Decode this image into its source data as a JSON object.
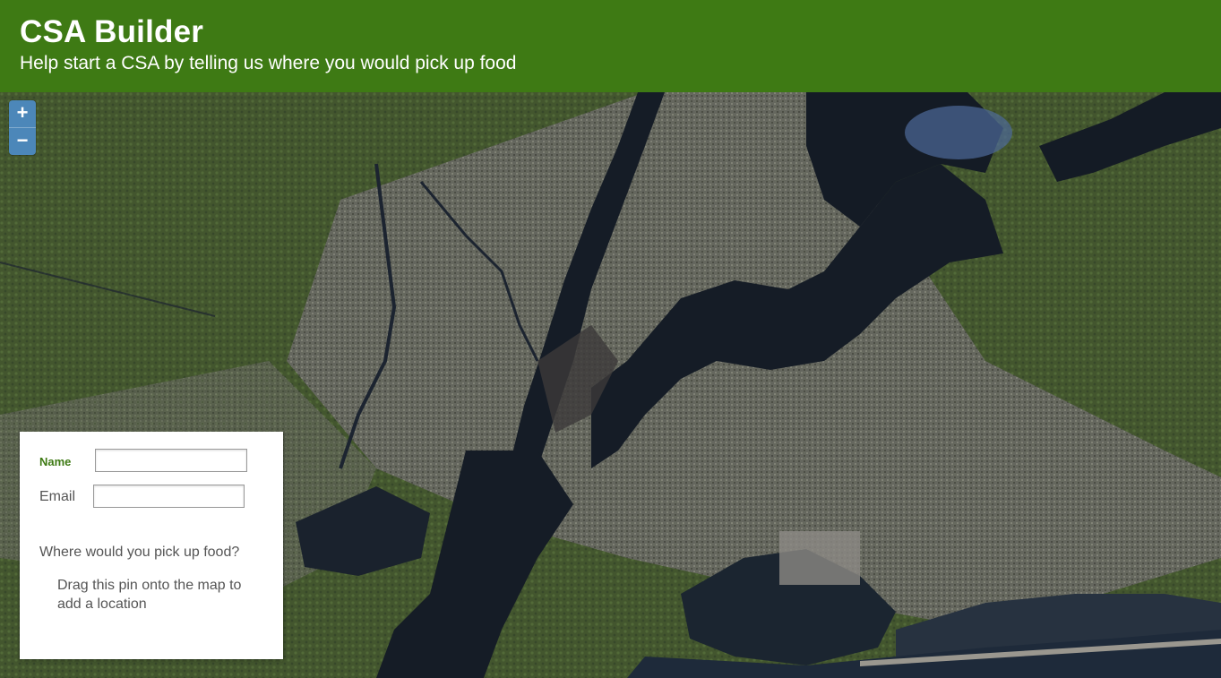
{
  "header": {
    "title": "CSA Builder",
    "subtitle": "Help start a CSA by telling us where you would pick up food"
  },
  "zoom": {
    "in_label": "+",
    "out_label": "−"
  },
  "form": {
    "name_label": "Name",
    "name_value": "",
    "email_label": "Email",
    "email_value": "",
    "question": "Where would you pick up food?",
    "hint": "Drag this pin  onto the map to add a location"
  },
  "colors": {
    "header_bg": "#3e7a14",
    "accent_label": "#3e7a14",
    "zoom_bg": "#4c87b9",
    "water": "#151c26"
  }
}
